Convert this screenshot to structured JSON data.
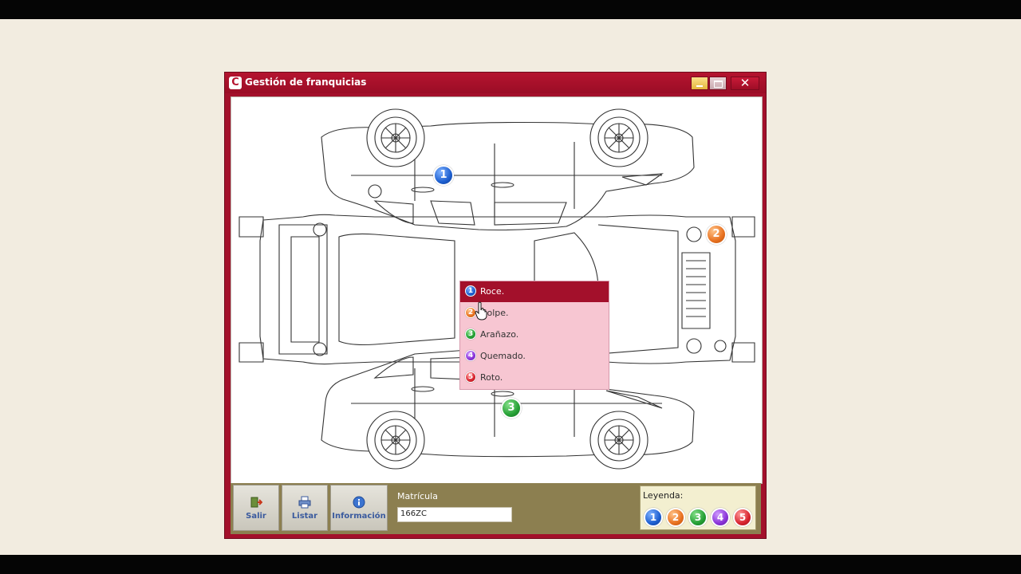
{
  "window": {
    "icon_letter": "C",
    "title": "Gestión de franquicias",
    "close_glyph": "✕"
  },
  "markers_on_car": [
    {
      "number": "1",
      "color": "#1d5fd0"
    },
    {
      "number": "2",
      "color": "#e8711f"
    },
    {
      "number": "3",
      "color": "#25a035"
    }
  ],
  "context_menu": {
    "items": [
      {
        "number": "1",
        "label": "Roce.",
        "color": "#1d5fd0",
        "selected": true
      },
      {
        "number": "2",
        "label": "Golpe.",
        "color": "#e8711f",
        "selected": false
      },
      {
        "number": "3",
        "label": "Arañazo.",
        "color": "#25a035",
        "selected": false
      },
      {
        "number": "4",
        "label": "Quemado.",
        "color": "#8a34d8",
        "selected": false
      },
      {
        "number": "5",
        "label": "Roto.",
        "color": "#d8242f",
        "selected": false
      }
    ]
  },
  "toolbar": {
    "salir_label": "Salir",
    "listar_label": "Listar",
    "info_label": "Información",
    "matricula_label": "Matrícula",
    "matricula_value": "166ZC"
  },
  "legend": {
    "title": "Leyenda:",
    "items": [
      {
        "number": "1",
        "color": "#1d5fd0"
      },
      {
        "number": "2",
        "color": "#e8711f"
      },
      {
        "number": "3",
        "color": "#25a035"
      },
      {
        "number": "4",
        "color": "#8a34d8"
      },
      {
        "number": "5",
        "color": "#d8242f"
      }
    ]
  },
  "colors": {
    "window_frame": "#a3102b",
    "toolbar": "#8c7f50",
    "menu_background": "#f7c6d2",
    "menu_selected": "#a3102b"
  }
}
